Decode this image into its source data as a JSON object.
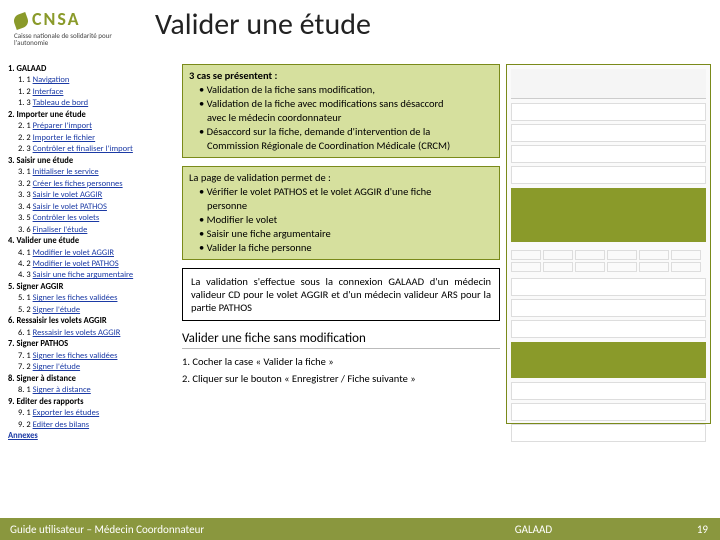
{
  "logo": {
    "name": "CNSA",
    "sub": "Caisse nationale de\nsolidarité pour l'autonomie"
  },
  "title": "Valider une étude",
  "toc": [
    {
      "t": "h1",
      "txt": "1. GALAAD"
    },
    {
      "t": "h2",
      "pre": "1. 1 ",
      "txt": "Navigation"
    },
    {
      "t": "h2",
      "pre": "1. 2 ",
      "txt": "Interface"
    },
    {
      "t": "h2",
      "pre": "1. 3 ",
      "txt": "Tableau de bord"
    },
    {
      "t": "h1",
      "txt": "2. Importer une étude"
    },
    {
      "t": "h2",
      "pre": "2. 1 ",
      "txt": "Préparer l'import"
    },
    {
      "t": "h2",
      "pre": "2. 2 ",
      "txt": "Importer le fichier"
    },
    {
      "t": "h2",
      "pre": "2. 3 ",
      "txt": "Contrôler et finaliser l'import"
    },
    {
      "t": "h1",
      "txt": "3. Saisir une étude"
    },
    {
      "t": "h2",
      "pre": "3. 1 ",
      "txt": "Initialiser le service"
    },
    {
      "t": "h2",
      "pre": "3. 2 ",
      "txt": "Créer les fiches personnes"
    },
    {
      "t": "h2",
      "pre": "3. 3 ",
      "txt": "Saisir le volet AGGIR"
    },
    {
      "t": "h2",
      "pre": "3. 4 ",
      "txt": "Saisir le volet PATHOS"
    },
    {
      "t": "h2",
      "pre": "3. 5 ",
      "txt": "Contrôler les volets"
    },
    {
      "t": "h2",
      "pre": "3. 6 ",
      "txt": "Finaliser l'étude"
    },
    {
      "t": "h1",
      "txt": "4. Valider une étude"
    },
    {
      "t": "h2",
      "pre": "4. 1 ",
      "txt": "Modifier le volet AGGIR"
    },
    {
      "t": "h2",
      "pre": "4. 2 ",
      "txt": "Modifier le volet PATHOS"
    },
    {
      "t": "h2",
      "pre": "4. 3 ",
      "txt": "Saisir une fiche argumentaire"
    },
    {
      "t": "h1",
      "txt": "5. Signer AGGIR"
    },
    {
      "t": "h2",
      "pre": "5. 1 ",
      "txt": "Signer les fiches validées"
    },
    {
      "t": "h2",
      "pre": "5. 2 ",
      "txt": "Signer l'étude"
    },
    {
      "t": "h1",
      "txt": "6. Ressaisir les volets AGGIR"
    },
    {
      "t": "h2",
      "pre": "6. 1 ",
      "txt": "Ressaisir les volets AGGIR"
    },
    {
      "t": "h1",
      "txt": "7. Signer PATHOS"
    },
    {
      "t": "h2",
      "pre": "7. 1 ",
      "txt": "Signer les fiches validées"
    },
    {
      "t": "h2",
      "pre": "7. 2 ",
      "txt": "Signer l'étude"
    },
    {
      "t": "h1",
      "txt": "8. Signer à distance"
    },
    {
      "t": "h2",
      "pre": "8. 1 ",
      "txt": "Signer à distance"
    },
    {
      "t": "h1",
      "txt": "9. Editer des rapports"
    },
    {
      "t": "h2",
      "pre": "9. 1 ",
      "txt": "Exporter les études"
    },
    {
      "t": "h2",
      "pre": "9. 2 ",
      "txt": "Editer des bilans"
    },
    {
      "t": "ann",
      "txt": "Annexes"
    }
  ],
  "box1": {
    "l0": "3 cas se présentent :",
    "l1": "• Validation de la fiche sans modification,",
    "l2": "• Validation de la fiche avec modifications sans désaccord",
    "l2b": "avec le médecin coordonnateur",
    "l3": "• Désaccord sur la fiche, demande d'intervention de la",
    "l3b": "Commission Régionale de Coordination Médicale (CRCM)"
  },
  "box2": {
    "l0": "La page de validation permet de :",
    "l1": "• Vérifier le volet PATHOS et le volet AGGIR d'une fiche",
    "l1b": "personne",
    "l2": "• Modifier le volet",
    "l3": "• Saisir une fiche argumentaire",
    "l4": "• Valider la fiche personne"
  },
  "box3": "La validation s'effectue sous la connexion GALAAD d'un médecin valideur CD pour le volet AGGIR et d'un médecin valideur ARS pour la partie PATHOS",
  "subheading": "Valider une fiche sans modification",
  "step1": "1. Cocher la case « Valider la fiche »",
  "step2": "2. Cliquer sur le bouton « Enregistrer / Fiche suivante »",
  "footer": {
    "left": "Guide utilisateur – Médecin Coordonnateur",
    "center": "GALAAD",
    "page": "19"
  }
}
